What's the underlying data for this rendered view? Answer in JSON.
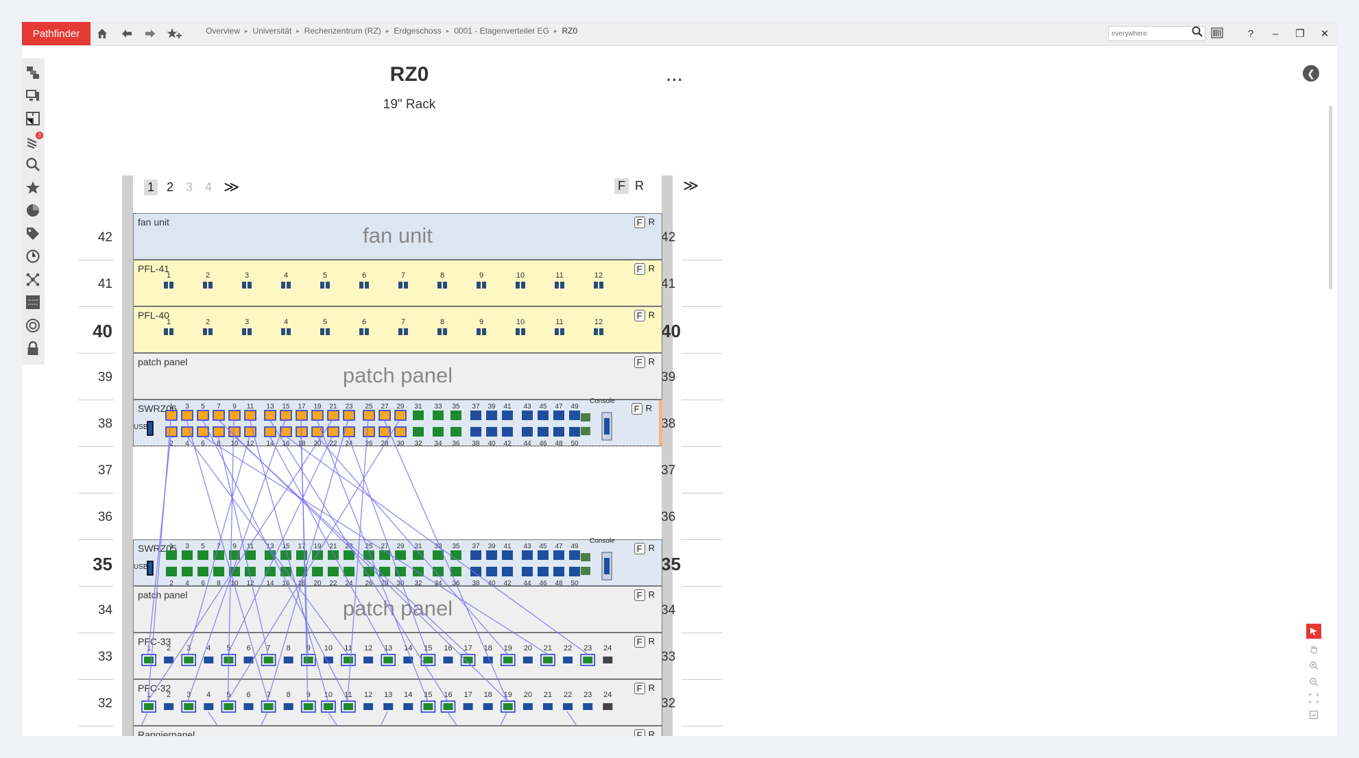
{
  "app": {
    "brand": "Pathfinder"
  },
  "breadcrumb": [
    "Overview",
    "Universität",
    "Rechenzentrum (RZ)",
    "Erdgeschoss",
    "0001 - Etagenverteiler EG",
    "RZ0"
  ],
  "search": {
    "placeholder": "everywhere"
  },
  "window": {
    "help": "?",
    "minimize": "–",
    "restore": "❐",
    "close": "✕"
  },
  "sidebar": {
    "notifications_badge": "3"
  },
  "page": {
    "title": "RZ0",
    "subtitle": "19\" Rack",
    "more": "···"
  },
  "pager": {
    "pages": [
      "1",
      "2",
      "3",
      "4"
    ],
    "active": "1",
    "next": "≫"
  },
  "view_toggle": {
    "front": "F",
    "rear": "R"
  },
  "rack": {
    "units_left": [
      "42",
      "41",
      "40",
      "39",
      "38",
      "37",
      "36",
      "35",
      "34",
      "33",
      "32"
    ],
    "devices": [
      {
        "name": "fan unit",
        "big": "fan unit",
        "color": "#dbe6f1"
      },
      {
        "name": "PFL-41",
        "color": "#fdf7c3"
      },
      {
        "name": "PFL-40",
        "color": "#fdf7c3"
      },
      {
        "name": "patch panel",
        "big": "patch panel",
        "color": "#efefef"
      },
      {
        "name": "SWRZ06",
        "color": "#dfe8f2",
        "usb": "USB",
        "console": "Console"
      },
      {
        "name": "SWRZ05",
        "color": "#dfe8f2",
        "usb": "USB",
        "console": "Console"
      },
      {
        "name": "patch panel",
        "big": "patch panel",
        "color": "#efefef"
      },
      {
        "name": "PFC-33",
        "color": "#efefef"
      },
      {
        "name": "PFC-32",
        "color": "#efefef"
      },
      {
        "name": "Rangierpanel",
        "color": "#efefef"
      }
    ],
    "colors": {
      "orange": "#f5a623",
      "green": "#1e8a2e",
      "blue": "#1f4e9c",
      "gray": "#444444",
      "cable": "#7a73ef",
      "highlight": "#2b3bd4"
    }
  }
}
